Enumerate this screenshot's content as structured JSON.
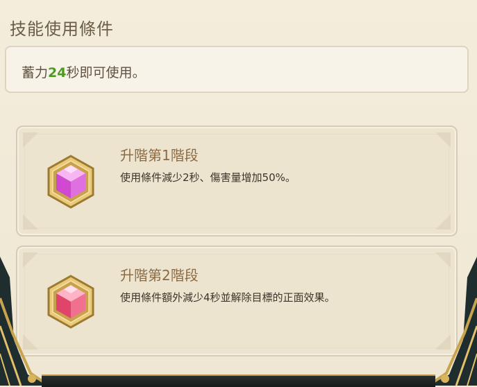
{
  "section": {
    "title": "技能使用條件"
  },
  "condition": {
    "prefix": "蓄力",
    "seconds": "24",
    "suffix": "秒即可使用。"
  },
  "stages": [
    {
      "title": "升階第1階段",
      "description": "使用條件減少2秒、傷害量增加50%。",
      "icon": "pink-cube-gem-icon"
    },
    {
      "title": "升階第2階段",
      "description": "使用條件額外減少4秒並解除目標的正面效果。",
      "icon": "red-cube-gem-icon"
    }
  ],
  "colors": {
    "highlight_number": "#4c9a1e",
    "stage_title": "#8b6a43",
    "panel_bg": "#f1ead8"
  }
}
